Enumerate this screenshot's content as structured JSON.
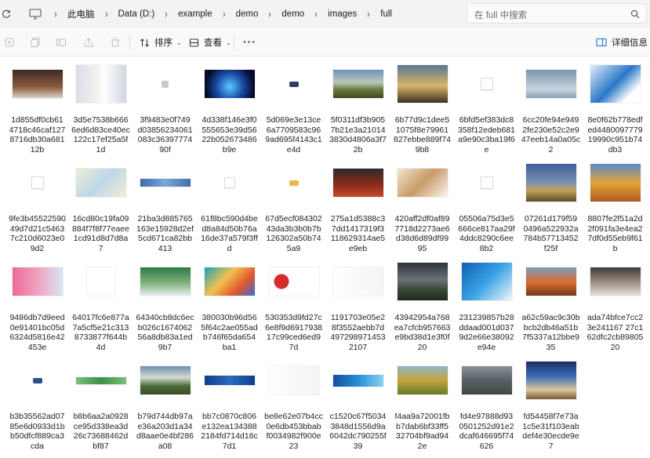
{
  "address_bar": {
    "breadcrumbs": [
      "此电脑",
      "Data (D:)",
      "example",
      "demo",
      "demo",
      "images",
      "full"
    ],
    "search_placeholder": "在 full 中搜索"
  },
  "toolbar": {
    "sort_label": "排序",
    "view_label": "查看",
    "more_label": "···",
    "details_label": "详细信息"
  },
  "files": [
    {
      "name": "1d855df0cb61\n4718c46caf127\n8716db30a681\n12b",
      "icon": "image-thumbnail"
    },
    {
      "name": "3d5e7538b666\n6ed6d83ce40ec\n122c17ef25a5f\n1d",
      "icon": "image-thumbnail"
    },
    {
      "name": "3f9483e0f749\nd03856234061\n083c36397774\n90f",
      "icon": "image-thumbnail"
    },
    {
      "name": "4d338f146e3f0\n555653e39d56\n22b052673486\nb9e",
      "icon": "image-thumbnail"
    },
    {
      "name": "5d069e3e13ce\n6a7709583c96\n9ad695f4143c1\ne4d",
      "icon": "image-thumbnail"
    },
    {
      "name": "5f0311df3b905\n7b21e3a21014\n3830d4806a3f7\n2b",
      "icon": "image-thumbnail"
    },
    {
      "name": "6b77d9c1dee5\n1075f8e79961\n827ebbe889f74\n9b8",
      "icon": "image-thumbnail"
    },
    {
      "name": "6bfd5ef383dc8\n358f12edeb681\na9e90c3ba19f6\ne",
      "icon": "image-thumbnail"
    },
    {
      "name": "6cc20fe94e949\n2fe230e52c2e9\n47eeb14a0a05c\n2",
      "icon": "image-thumbnail"
    },
    {
      "name": "8e0f62b778edf\ned4480097779\n19990c951b74\ndb3",
      "icon": "image-thumbnail"
    },
    {
      "name": "9fe3b45522590\n49d7d21c5463\n7c210d6023e0\n9d2",
      "icon": "image-thumbnail"
    },
    {
      "name": "16cd80c19fa09\n884f7f8f77eaee\n1cd91d8d7d8a\n7",
      "icon": "image-thumbnail"
    },
    {
      "name": "21ba3d885765\n163e15928d2ef\n5cd671ca82bb\n413",
      "icon": "image-thumbnail"
    },
    {
      "name": "61f8bc590d4be\nd8a84d50b76a\n16de37a579f3ff\nd",
      "icon": "image-thumbnail"
    },
    {
      "name": "67d5ecf084302\n43da3b3b0b7b\n126302a50b74\n5a9",
      "icon": "image-thumbnail"
    },
    {
      "name": "275a1d5388c3\n7dd1417319f3\n118629314ae5\ne9eb",
      "icon": "image-thumbnail"
    },
    {
      "name": "420aff2df0af89\n7718d2273ae6\nd38d6d89df99\n95",
      "icon": "image-thumbnail"
    },
    {
      "name": "05506a75d3e5\n666ce817aa29f\n4ddc8290c6ee\n8b2",
      "icon": "image-thumbnail"
    },
    {
      "name": "07261d179f59\n0496a522932a\n784b57713452\nf25f",
      "icon": "image-thumbnail"
    },
    {
      "name": "8807fe2f51a2d\n2f091fa3e4ea2\n7df0d55eb9f61\nb",
      "icon": "image-thumbnail"
    },
    {
      "name": "9486db7d9eed\n0e91401bc05d\n6324d5816e42\n453e",
      "icon": "image-thumbnail"
    },
    {
      "name": "64017fc6e877a\n7a5cf5e21c313\n8733877f644b\n4d",
      "icon": "image-thumbnail"
    },
    {
      "name": "64340cb8dc6ec\nb026c1674062\n56a8db83a1ed\n9b7",
      "icon": "image-thumbnail"
    },
    {
      "name": "380030b96d56\n5f64c2ae055ad\nb746f65da654\nba1",
      "icon": "image-thumbnail"
    },
    {
      "name": "530353d9fd27c\n6e8f9d6917938\n17c99ced6ed9\n7d",
      "icon": "image-thumbnail"
    },
    {
      "name": "1191703e05e2\n8f3552aebb7d\n497298971453\n2107",
      "icon": "image-thumbnail"
    },
    {
      "name": "43942954a768\nea7cfcb957663\ne9bd38d1e3f0f\n20",
      "icon": "image-thumbnail"
    },
    {
      "name": "231239857b28\nddaad001d037\n9d2e66e38092\ne94e",
      "icon": "image-thumbnail"
    },
    {
      "name": "a62c59ac9c30b\nbcb2db46a51b\n7f5337a12bbe9\n35",
      "icon": "image-thumbnail"
    },
    {
      "name": "ada74bfce7cc2\n3e241167 27c1\n62dfc2cb89805\n20",
      "icon": "image-thumbnail"
    },
    {
      "name": "b3b35562ad07\n85e6d0933d1b\nb50dfcf889ca3\ncda",
      "icon": "image-thumbnail"
    },
    {
      "name": "b8b6aa2a0928\nce95d338ea3d\n26c73688462d\nbf87",
      "icon": "image-thumbnail"
    },
    {
      "name": "b79d744db97a\ne36a203d1a34\nd8aae0e4bf286\na08",
      "icon": "image-thumbnail"
    },
    {
      "name": "bb7c0870c806\ne132ea134388\n2184fd714d18c\n7d1",
      "icon": "image-thumbnail"
    },
    {
      "name": "be8e62e07b4cc\n0e6db453bbab\nf0034982f900e\n23",
      "icon": "image-thumbnail"
    },
    {
      "name": "c1520c67f5034\n3848d1556d9a\n6042dc790255f\n39",
      "icon": "image-thumbnail"
    },
    {
      "name": "f4aa9a72001fb\nb7dab6bf33ff5\n32704bf9ad94\n2e",
      "icon": "image-thumbnail"
    },
    {
      "name": "fd4e97888d93\n0501252d91e2\ndcaf646695f74\n626",
      "icon": "image-thumbnail"
    },
    {
      "name": "fd54458f7e73a\n1c5e31f103eab\ndef4e30ecde9e\n7",
      "icon": "image-thumbnail"
    }
  ]
}
